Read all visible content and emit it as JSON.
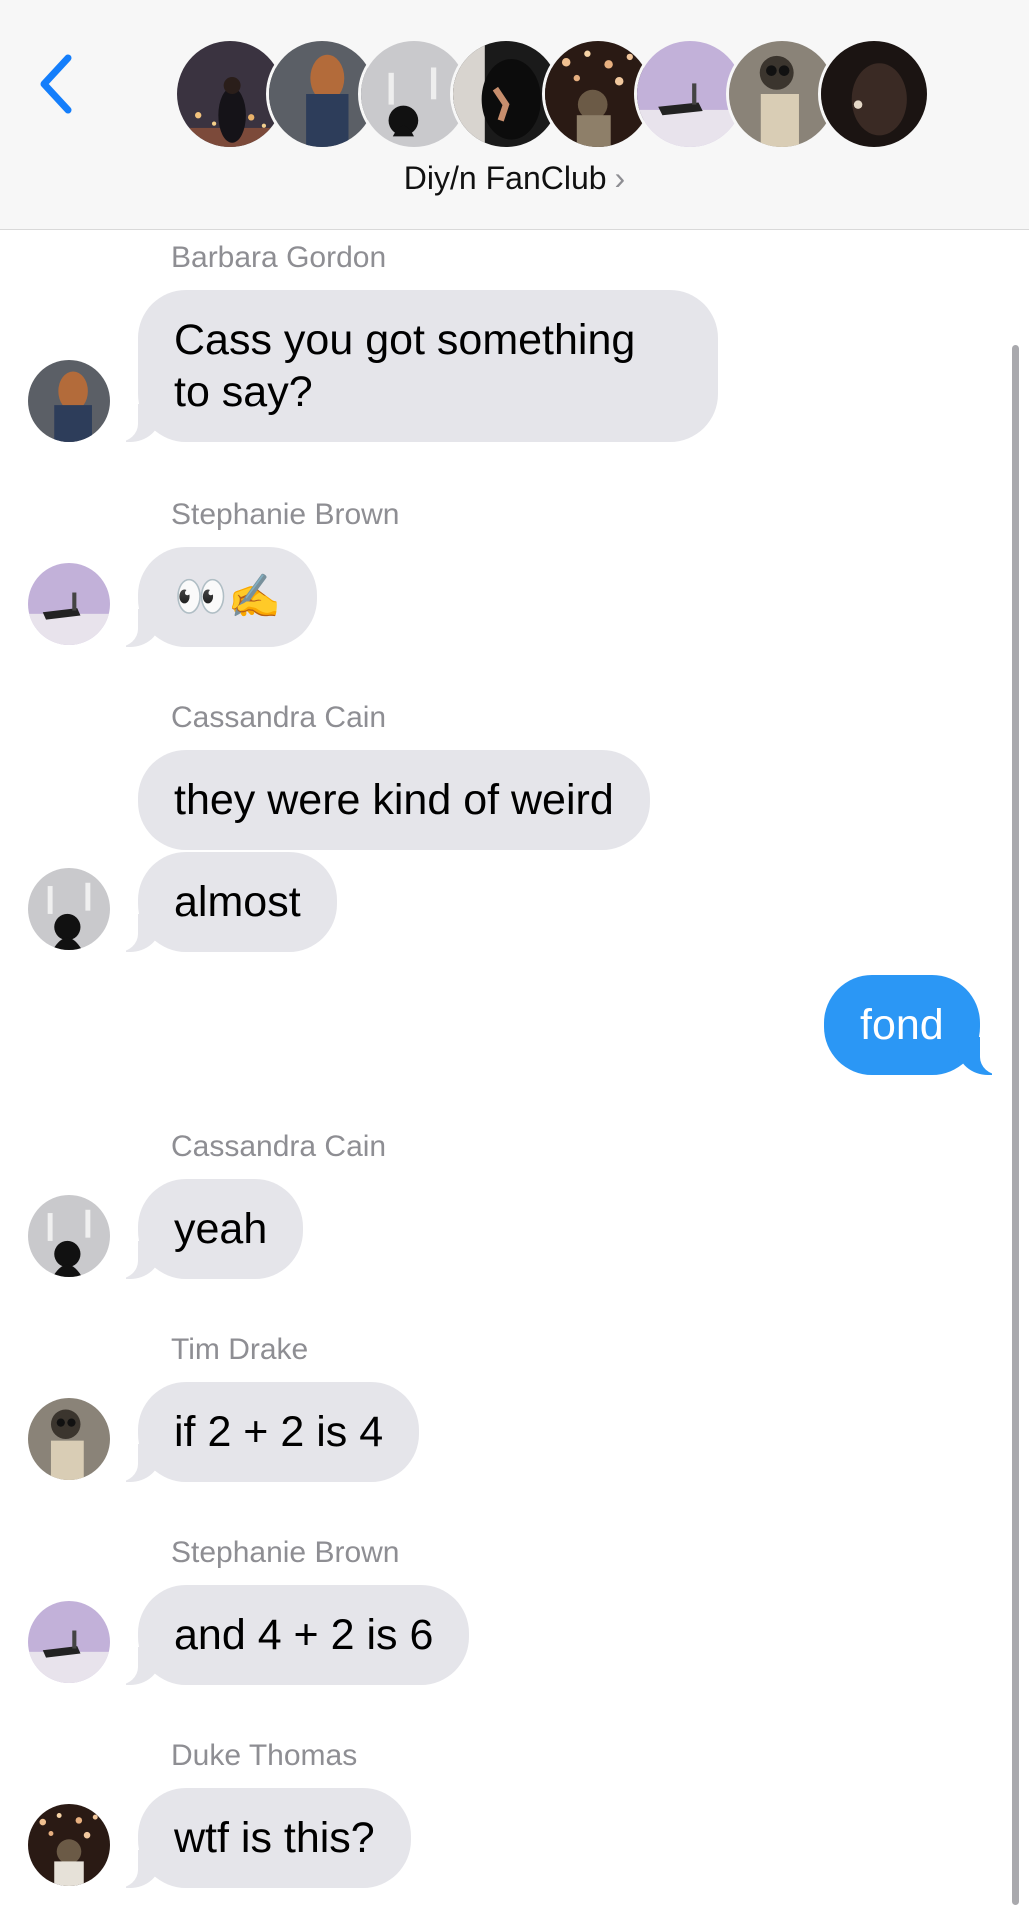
{
  "header": {
    "group_name": "Diy/n FanClub",
    "chevron": "›",
    "back_icon": "chevron-left-icon"
  },
  "colors": {
    "incoming_bubble": "#e5e5ea",
    "outgoing_bubble": "#2b97f5",
    "accent": "#147efb",
    "sender_label": "#8e8e93"
  },
  "messages": [
    {
      "sender": "Barbara Gordon",
      "text": "Cass you got something\nto say?"
    },
    {
      "sender": "Stephanie Brown",
      "text": "👀✍️"
    },
    {
      "sender": "Cassandra Cain",
      "text": "they were kind of weird"
    },
    {
      "text": "almost"
    },
    {
      "outgoing": true,
      "text": "fond"
    },
    {
      "sender": "Cassandra Cain",
      "text": "yeah"
    },
    {
      "sender": "Tim Drake",
      "text": "if 2 + 2 is 4"
    },
    {
      "sender": "Stephanie Brown",
      "text": "and 4 + 2 is 6"
    },
    {
      "sender": "Duke Thomas",
      "text": "wtf is this?"
    }
  ]
}
